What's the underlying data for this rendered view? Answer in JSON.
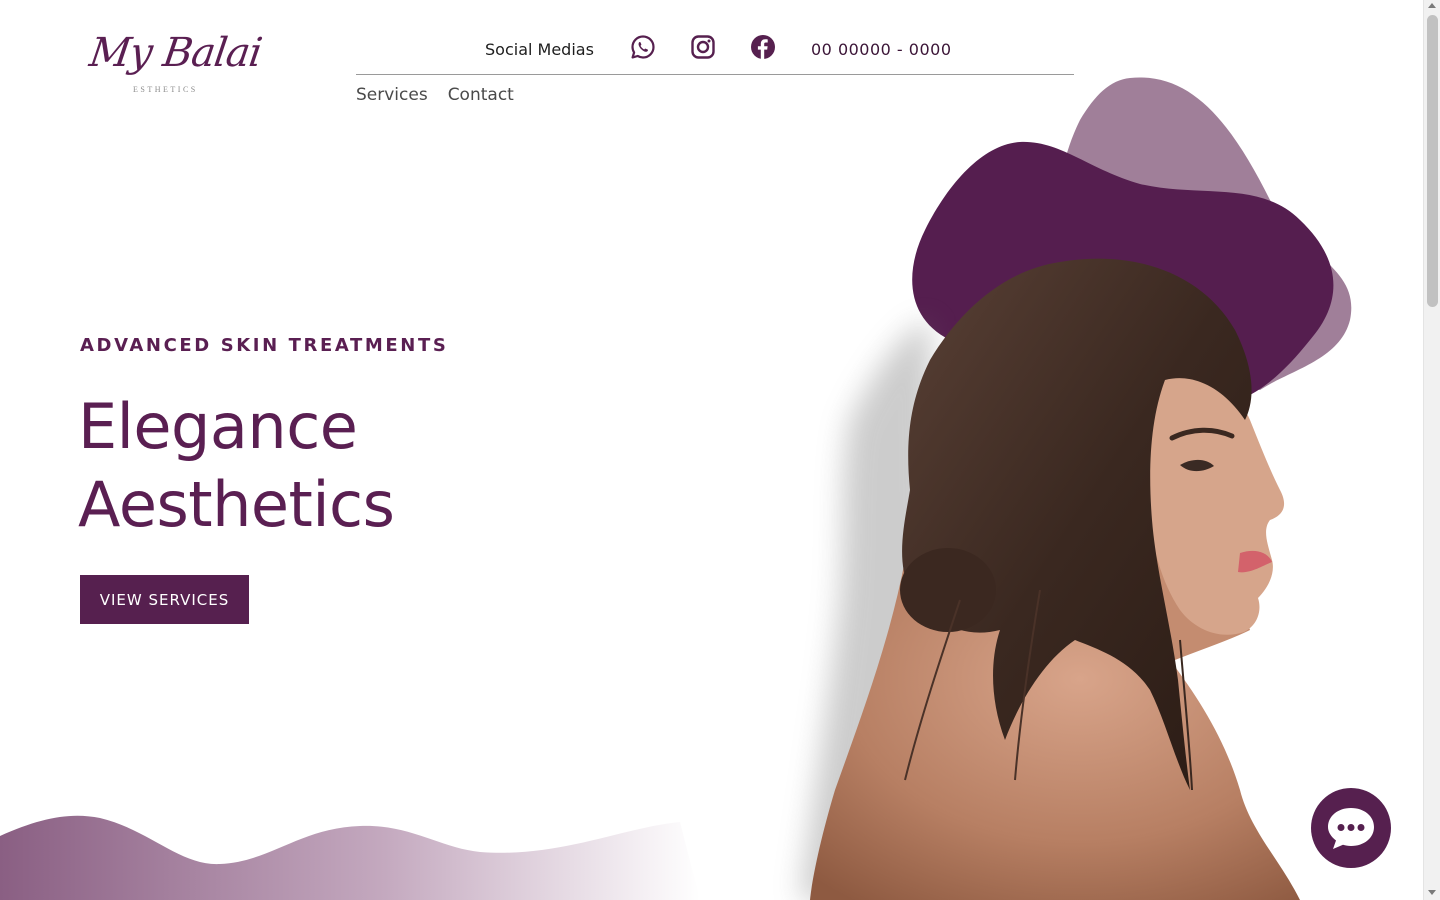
{
  "logo": {
    "script": "My Balai",
    "subtitle": "ESTHETICS"
  },
  "header": {
    "social_label": "Social Medias",
    "social_icons": [
      "whatsapp-icon",
      "instagram-icon",
      "facebook-icon"
    ],
    "phone": "00 00000 - 0000"
  },
  "nav": {
    "items": [
      {
        "label": "Services"
      },
      {
        "label": "Contact"
      }
    ]
  },
  "hero": {
    "eyebrow": "ADVANCED SKIN TREATMENTS",
    "title_line1": "Elegance",
    "title_line2": "Aesthetics",
    "cta_label": "VIEW SERVICES"
  },
  "chat": {
    "icon": "chat-bubble-icon"
  },
  "colors": {
    "brand": "#56204f",
    "brand_light": "#a07f99",
    "accent_text": "#5a1f52"
  }
}
